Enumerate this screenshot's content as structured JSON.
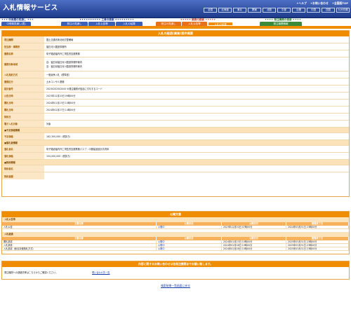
{
  "header": {
    "logo": "入札情報サービス",
    "links": [
      "✦ヘルプ",
      "✦お問い合わせ",
      "✦全国版TOP"
    ],
    "regions": [
      "全国",
      "北海道",
      "東北",
      "関東",
      "北陸",
      "中部",
      "近畿",
      "中国",
      "四国",
      "九州沖縄"
    ]
  },
  "nav": {
    "sections": [
      {
        "label": "✦✦✦ 中長期の見通し ✦✦✦",
        "color": "#1e3a8a",
        "tabs": [
          {
            "l": "中長期見通し(表)",
            "c": "#3c5fb8"
          }
        ]
      },
      {
        "label": "✦✦✦✦✦✦✦✦✦✦ 工事の検索 ✦✦✦✦✦✦✦✦✦",
        "color": "#1e3a8a",
        "tabs": [
          {
            "l": "発注の見通し",
            "c": "#3c5fb8"
          },
          {
            "l": "入札公告等",
            "c": "#3c5fb8"
          },
          {
            "l": "入札の結果",
            "c": "#3c5fb8"
          }
        ]
      },
      {
        "label": "✦✦✦✦✦ 業務の検索 ✦✦✦✦✦",
        "color": "#c0392b",
        "tabs": [
          {
            "l": "発注の見通し",
            "c": "#e8701a"
          },
          {
            "l": "入札公告等",
            "c": "#e8701a"
          },
          {
            "l": "入札の結果",
            "c": "#e8701a"
          }
        ]
      },
      {
        "label": "✦✦✦✦ 発注機関の検索 ✦✦✦✦",
        "color": "#2a7a2a",
        "tabs": [
          {
            "l": "発注機関情報",
            "c": "#3a8a3a"
          }
        ]
      }
    ]
  },
  "main": {
    "title": "入札の経過(業務)案件概要",
    "rows": [
      [
        "発注機関",
        "国土交通省東北地方整備局"
      ],
      [
        "担当部・事務所",
        "福島河川国道事務所"
      ],
      [
        "業務名称",
        "衛子路道福内外工事監督支援業務"
      ],
      [
        "業務対象地域",
        "自：福島県福島河川国道事務所管内\n至：福島県福島河川国道事務所管内"
      ],
      [
        "入札契約方式",
        "一般競争入札（標準型）"
      ],
      [
        "業務区分",
        "土木コンサル業務"
      ],
      [
        "設計番号",
        "20230202502000   ※発注機関が独自に付与するコード"
      ],
      [
        "公告日時",
        "2023年12月20日 09時00分"
      ],
      [
        "開札日時",
        "2024年01月23日 10時00分"
      ],
      [
        "開札日時",
        "2024年02月27日 14時00分"
      ],
      [
        "契約日",
        ""
      ],
      [
        "電子入札対象",
        "対象"
      ]
    ],
    "sub1": "■予定価格情報",
    "r2": [
      [
        "予定価格",
        "162,300,000（税抜き）"
      ]
    ],
    "sub2": "■落札者情報",
    "r3": [
      [
        "落札者名",
        "衛子路道福内外工事監督支援業務パスプ・中郡建設設計共同体"
      ],
      [
        "落札価格",
        "154,000,000（税抜き）"
      ]
    ],
    "sub3": "■契約情報",
    "r4": [
      [
        "契約者名",
        ""
      ],
      [
        "契約金額",
        ""
      ]
    ]
  },
  "docs": {
    "title": "公開文書",
    "headers": [
      "文書名称",
      "公開状況",
      "公開日付",
      "閲覧終了日"
    ],
    "g1": "入札公告等",
    "g1rows": [
      [
        "入札公告",
        "公開中",
        "2023年12月20日 07時00分",
        "2024年03月31日 23時00分"
      ]
    ],
    "g2": "入札経過",
    "g2rows": [
      [
        "開札調書",
        "公開中",
        "2024年01月23日 10時00分",
        "2025年03月31日 23時00分"
      ],
      [
        "入札調書",
        "公開中",
        "2024年02月28日 10時00分",
        "2025年03月31日 23時00分"
      ],
      [
        "入札調書（総合評価落札方式）",
        "公開中",
        "2024年02月28日 10時00分",
        "2025年03月31日 23時00分"
      ]
    ]
  },
  "note": {
    "title": "内容に関するお問い合わせは各発注機関までお願い致します。",
    "text": "発注機関への連絡先等はこちらからご確認ください。",
    "link": "問い合わせ先一覧"
  },
  "back": "検索結果一覧画面に戻る"
}
